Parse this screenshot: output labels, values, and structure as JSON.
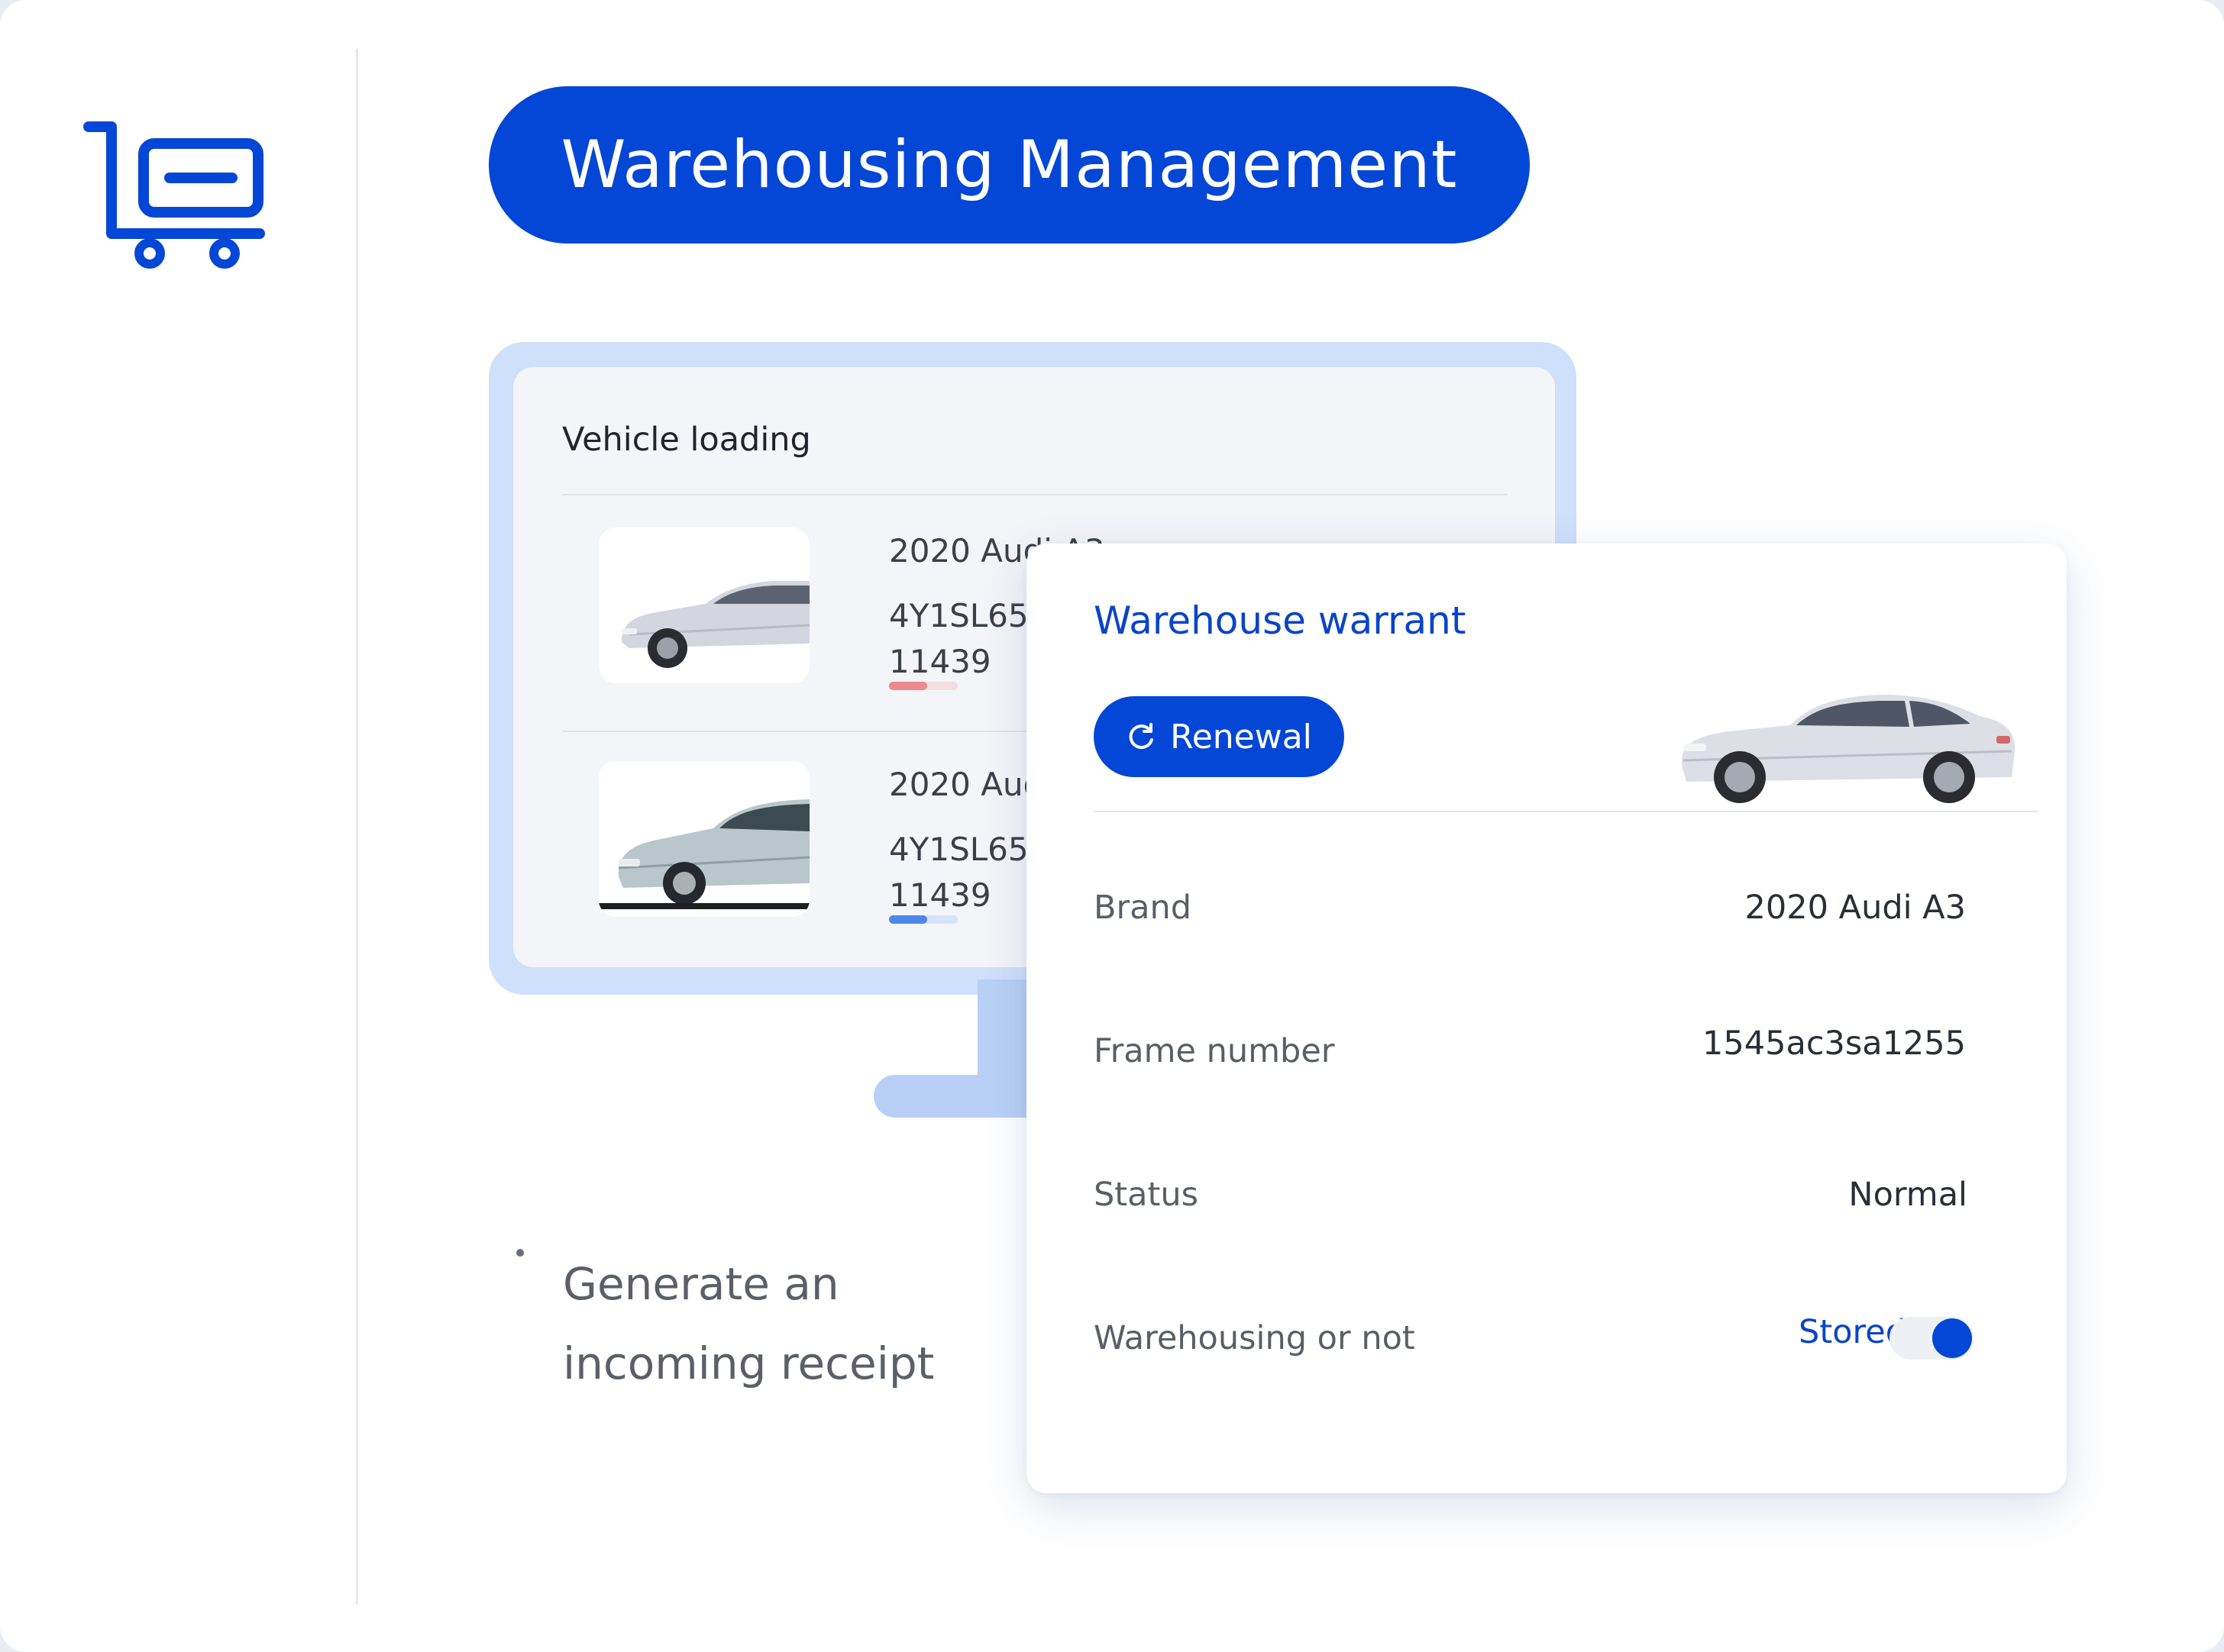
{
  "header": {
    "icon": "cart-icon",
    "title": "Warehousing Management"
  },
  "vehicle_loading": {
    "title": "Vehicle loading",
    "items": [
      {
        "name": "2020 Audi A3",
        "code_line1": "4Y1SL658",
        "code_line2": "11439",
        "progress": 0.55,
        "progress_color": "#ec8a8f",
        "track_color": "#f3dfe0"
      },
      {
        "name": "2020 Audi A3",
        "code_line1": "4Y1SL658",
        "code_line2": "11439",
        "progress": 0.55,
        "progress_color": "#4f86ea",
        "track_color": "#d5e3fa"
      }
    ]
  },
  "note": {
    "text_line1": "Generate an",
    "text_line2": "incoming receipt"
  },
  "warrant": {
    "title": "Warehouse warrant",
    "renewal_label": "Renewal",
    "renewal_icon": "refresh-icon",
    "fields": {
      "brand_label": "Brand",
      "brand_value": "2020 Audi A3",
      "frame_label": "Frame number",
      "frame_value": "1545ac3sa1255",
      "status_label": "Status",
      "status_value": "Normal",
      "warehousing_label": "Warehousing or not",
      "warehousing_value": "Stored",
      "warehousing_on": true
    }
  },
  "colors": {
    "accent": "#0447d6",
    "accent_text": "#0a44c8",
    "monitor": "#cfe0fa"
  }
}
